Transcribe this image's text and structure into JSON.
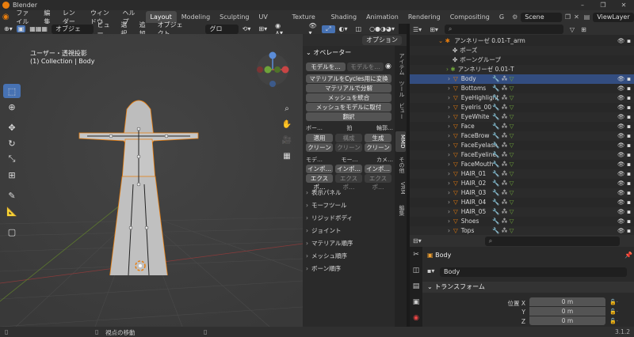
{
  "app": {
    "title": "Blender",
    "version": "3.1.2"
  },
  "menus": [
    "ファイル",
    "編集",
    "レンダー",
    "ウィンドウ",
    "ヘルプ"
  ],
  "workspaces": [
    "Layout",
    "Modeling",
    "Sculpting",
    "UV Editing",
    "Texture Paint",
    "Shading",
    "Animation",
    "Rendering",
    "Compositing",
    "G"
  ],
  "scene": "Scene",
  "view_layer": "ViewLayer",
  "viewport_header": {
    "mode": "オブジェク…",
    "items": [
      "ビュー",
      "選択",
      "追加",
      "オブジェクト"
    ],
    "orientation": "グロー…",
    "options": "オプション"
  },
  "viewport": {
    "title": "ユーザー・透視投影",
    "subtitle": "(1) Collection | Body"
  },
  "npanel": {
    "header": "オペレーター",
    "model_btn1": "モデルを…",
    "model_btn2": "モデルを…",
    "buttons": [
      "マテリアルをCycles用に変換",
      "マテリアルで分解",
      "メッシュを統合",
      "メッシュをモデルに取付",
      "翻訳"
    ],
    "row1_labels": [
      "ボー…",
      "拍",
      "輪郭…"
    ],
    "row2": [
      "適用",
      "構成",
      "生成"
    ],
    "row3": [
      "クリーン",
      "クリーン",
      "クリーン"
    ],
    "row4_labels": [
      "モデ…",
      "モー…",
      "カメ…"
    ],
    "row5": [
      "インポ…",
      "インポ…",
      "インポ…"
    ],
    "row6": [
      "エクスポ…",
      "エクスポ…",
      "エクスポ…"
    ],
    "sections": [
      "表示パネル",
      "モーフツール",
      "リジッドボディ",
      "ジョイント",
      "マテリアル順序",
      "メッシュ順序",
      "ボーン順序"
    ]
  },
  "ntabs": [
    "アイテム",
    "ツール",
    "ビュー",
    "MMD",
    "その他",
    "VRM",
    "編集"
  ],
  "outliner": {
    "armature": "アンネリーゼ 0.01-T_arm",
    "pose": "ポーズ",
    "bone_group": "ボーングループ",
    "armature_data": "アンネリーゼ 0.01-T",
    "objects": [
      "Body",
      "Bottoms",
      "EyeHighlight",
      "EyeIris_00",
      "EyeWhite",
      "Face",
      "FaceBrow",
      "FaceEyelash",
      "FaceEyeline",
      "FaceMouth",
      "HAIR_01",
      "HAIR_02",
      "HAIR_03",
      "HAIR_04",
      "HAIR_05",
      "Shoes",
      "Tops"
    ],
    "selected": "Body"
  },
  "properties": {
    "object": "Body",
    "name_field": "Body",
    "transform": "トランスフォーム",
    "location_label": "位置 X",
    "y_label": "Y",
    "z_label": "Z",
    "x": "0 m",
    "y": "0 m",
    "z": "0 m"
  },
  "status": {
    "hint": "視点の移動",
    "version": "3.1.2"
  },
  "colors": {
    "accent": "#4772b3",
    "orange": "#e87d0d",
    "selected": "#334d80"
  }
}
